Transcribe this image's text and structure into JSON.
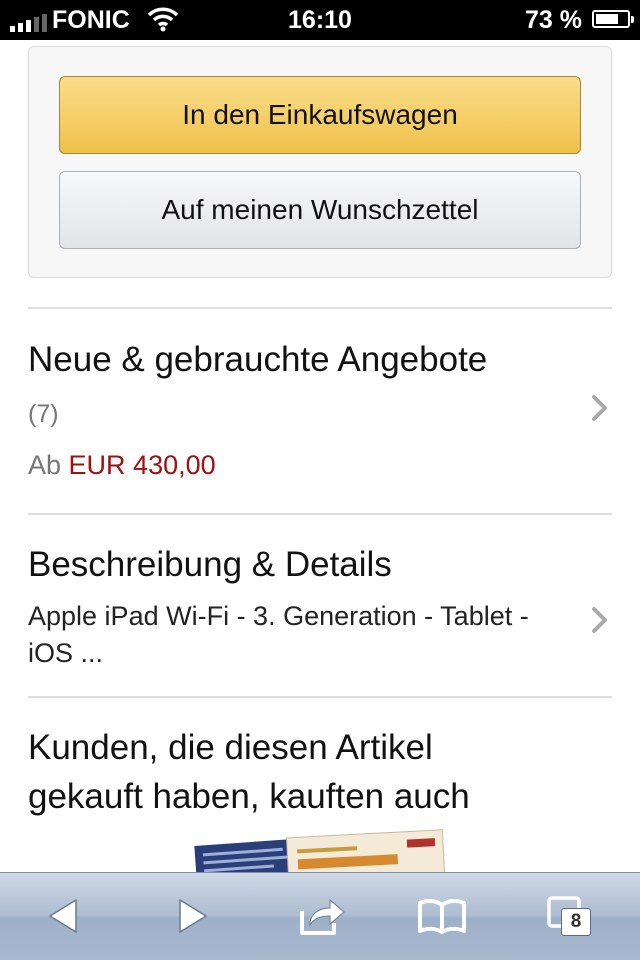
{
  "status_bar": {
    "carrier": "FONIC",
    "time": "16:10",
    "battery": "73 %",
    "battery_level": 0.73,
    "signal_icon": "signal-bars-icon",
    "wifi_icon": "wifi-icon",
    "battery_icon": "battery-icon"
  },
  "actions": {
    "add_to_cart": "In den Einkaufswagen",
    "add_to_wishlist": "Auf meinen Wunschzettel"
  },
  "offers": {
    "title": "Neue & gebrauchte Angebote",
    "count": "(7)",
    "from_label": "Ab",
    "price": "EUR 430,00"
  },
  "description": {
    "title": "Beschreibung & Details",
    "text": "Apple iPad Wi-Fi - 3. Generation - Tablet - iOS ..."
  },
  "also_bought": {
    "title_line1": "Kunden, die diesen Artikel",
    "title_line2": "gekauft haben, kauften auch"
  },
  "toolbar": {
    "back_icon": "back-arrow-icon",
    "forward_icon": "forward-arrow-icon",
    "share_icon": "share-icon",
    "bookmarks_icon": "bookmarks-book-icon",
    "tabs_icon": "tabs-icon",
    "tabs_count": "8"
  },
  "colors": {
    "primary_button": "#f0c14b",
    "price": "#a01010",
    "toolbar": "#aebdd1"
  }
}
